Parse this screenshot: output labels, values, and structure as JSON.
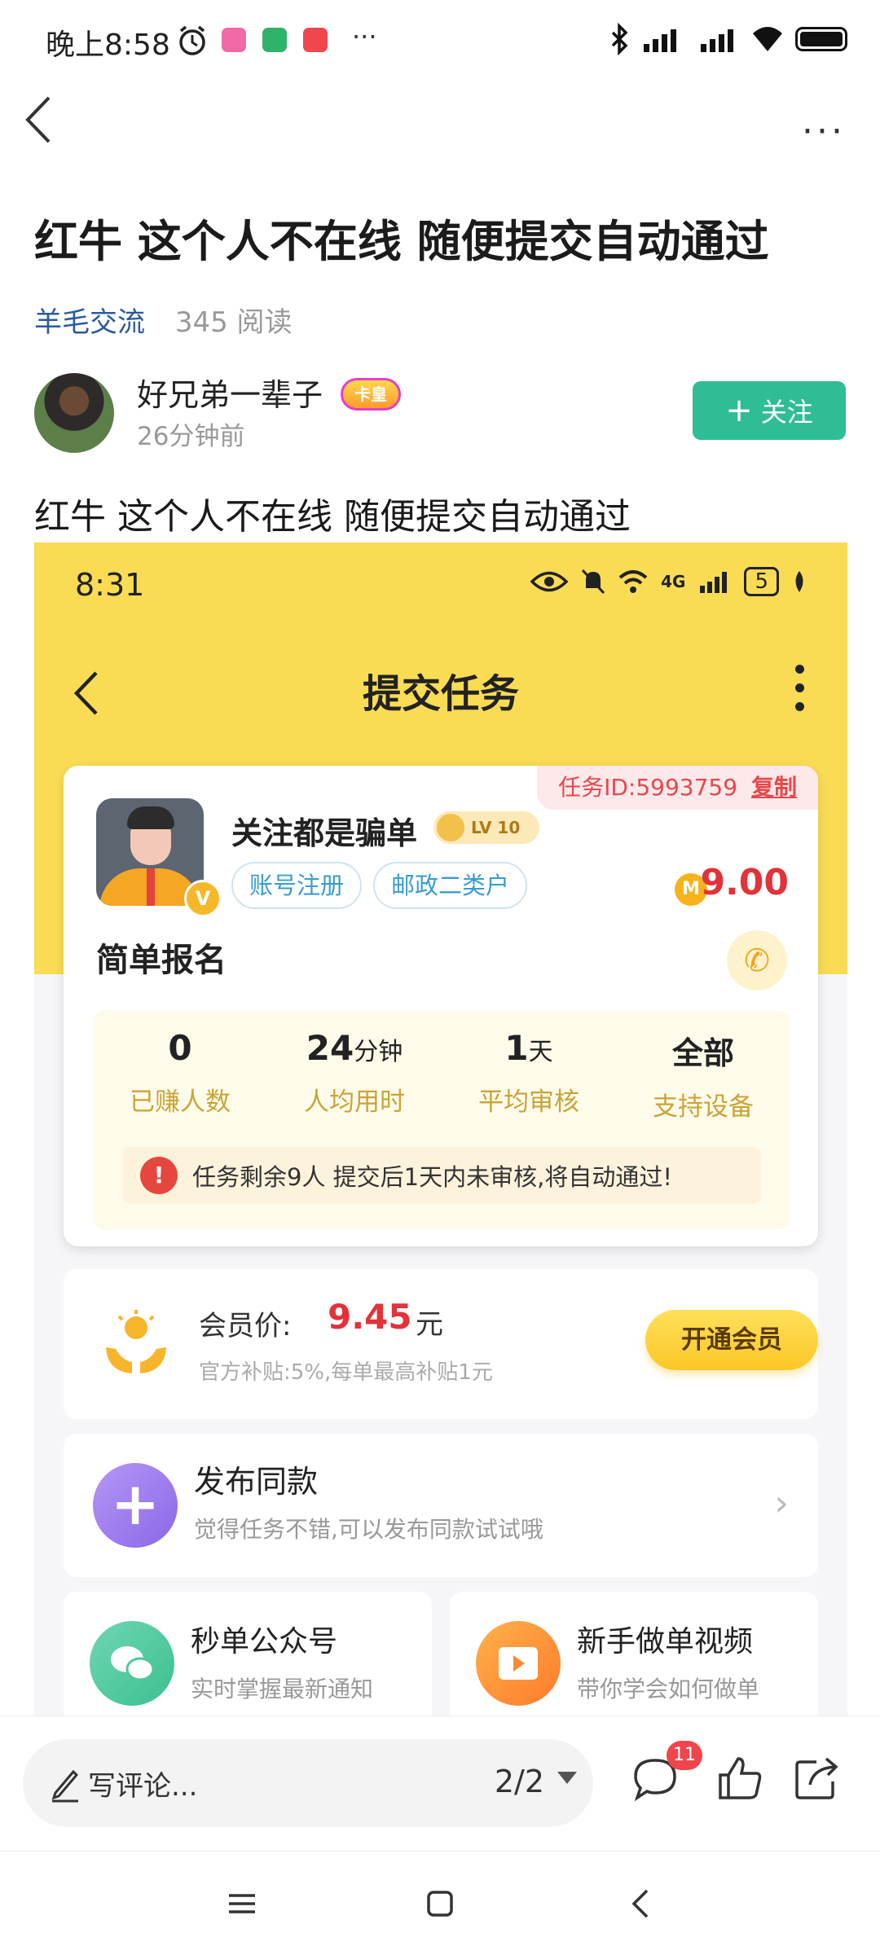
{
  "status_bar": {
    "time": "晚上8:58",
    "more": "···"
  },
  "header": {
    "more": "···"
  },
  "article": {
    "title": "红牛 这个人不在线 随便提交自动通过",
    "category": "羊毛交流",
    "reads": "345 阅读",
    "body": "红牛 这个人不在线  随便提交自动通过"
  },
  "author": {
    "name": "好兄弟一辈子",
    "vip_badge": "卡皇",
    "time": "26分钟前",
    "follow_label": "关注",
    "follow_plus": "+"
  },
  "embedded_screenshot": {
    "status": {
      "time": "8:31",
      "network": "4G",
      "battery": "5"
    },
    "title": "提交任务",
    "task_card": {
      "task_id_label": "任务ID:5993759",
      "copy_label": "复制",
      "username": "关注都是骗单",
      "level": "LV 10",
      "verified": "V",
      "tags": [
        "账号注册",
        "邮政二类户"
      ],
      "coin": "M",
      "price": "9.00",
      "task_type": "简单报名",
      "stats": [
        {
          "num": "0",
          "unit": "",
          "label": "已赚人数"
        },
        {
          "num": "24",
          "unit": "分钟",
          "label": "人均用时"
        },
        {
          "num": "1",
          "unit": "天",
          "label": "平均审核"
        },
        {
          "num": "全部",
          "unit": "",
          "label": "支持设备"
        }
      ],
      "notice": "任务剩余9人  提交后1天内未审核,将自动通过!"
    },
    "member": {
      "label": "会员价:",
      "price": "9.45",
      "unit": "元",
      "sub": "官方补贴:5%,每单最高补贴1元",
      "button": "开通会员"
    },
    "publish": {
      "title": "发布同款",
      "sub": "觉得任务不错,可以发布同款试试哦"
    },
    "mini_cards": [
      {
        "title": "秒单公众号",
        "sub": "实时掌握最新通知",
        "color_a": "#6fd6b4",
        "color_b": "#3cc08e"
      },
      {
        "title": "新手做单视频",
        "sub": "带你学会如何做单",
        "color_a": "#ffb14a",
        "color_b": "#ff7b2c"
      }
    ]
  },
  "bottom_bar": {
    "comment_placeholder": "写评论...",
    "page_indicator": "2/2",
    "comment_count": "11"
  },
  "colors": {
    "accent_green": "#2fbd95",
    "brand_yellow": "#fadc54",
    "price_red": "#e2323a",
    "link_blue": "#2b5a9c"
  },
  "icons": {
    "status": [
      "alarm-icon",
      "app-icon",
      "bluetooth-icon",
      "signal-icon",
      "wifi-icon",
      "battery-icon"
    ],
    "bottom": [
      "pen-icon",
      "comment-icon",
      "like-icon",
      "share-icon"
    ],
    "nav": [
      "menu-icon",
      "home-icon",
      "back-icon"
    ]
  }
}
